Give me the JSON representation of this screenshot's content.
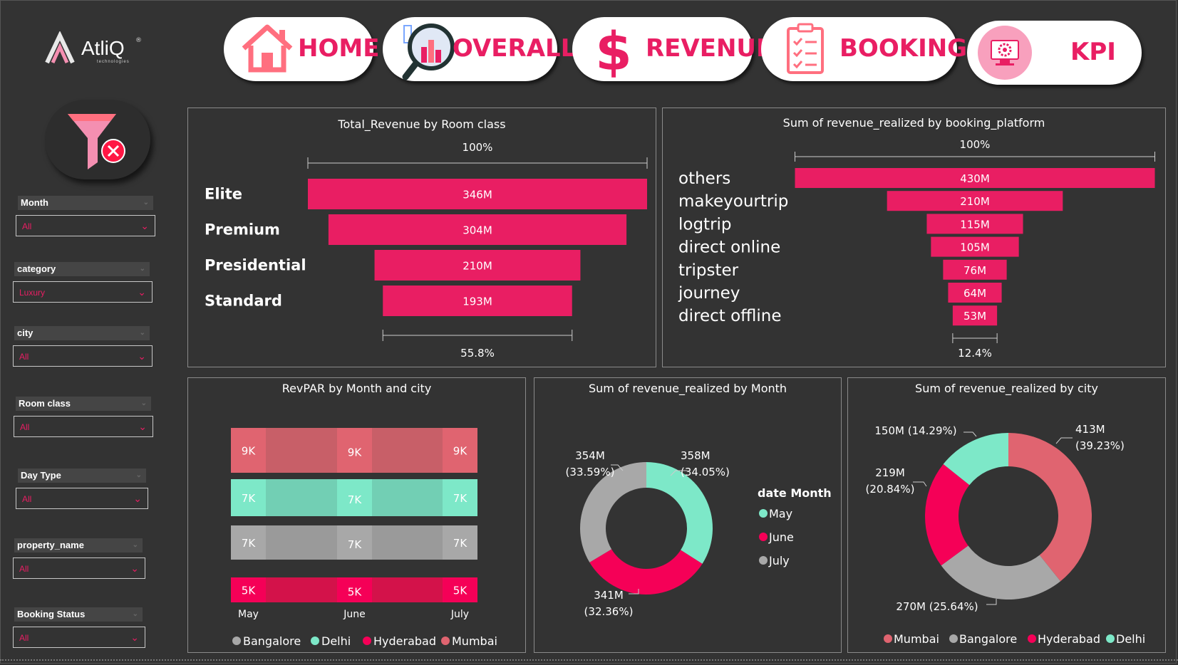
{
  "logo": {
    "name": "AtliQ",
    "sub": "technologies",
    "reg": "®"
  },
  "nav": [
    {
      "label": "HOME",
      "icon": "house-icon"
    },
    {
      "label": "OVERALL",
      "icon": "magnifier-chart-icon"
    },
    {
      "label": "REVENUE",
      "icon": "dollar-icon"
    },
    {
      "label": "BOOKING",
      "icon": "clipboard-checklist-icon"
    },
    {
      "label": "KPI",
      "icon": "gear-monitor-icon"
    }
  ],
  "filters": {
    "clear_icon": "funnel-clear-icon",
    "slicers": [
      {
        "title": "Month",
        "value": "All"
      },
      {
        "title": "category",
        "value": "Luxury"
      },
      {
        "title": "city",
        "value": "All"
      },
      {
        "title": "Room class",
        "value": "All"
      },
      {
        "title": "Day Type",
        "value": "All"
      },
      {
        "title": "property_name",
        "value": "All"
      },
      {
        "title": "Booking Status",
        "value": "All"
      }
    ]
  },
  "colors": {
    "pink": "#e91e63",
    "mumbai": "#e06470",
    "bangalore": "#a8a8a8",
    "hyderabad": "#f50057",
    "delhi": "#7de8c8"
  },
  "chart_data": [
    {
      "type": "bar",
      "subtype": "funnel",
      "title": "Total_Revenue by Room class",
      "categories": [
        "Elite",
        "Premium",
        "Presidential",
        "Standard"
      ],
      "values": [
        346,
        304,
        210,
        193
      ],
      "value_labels": [
        "346M",
        "304M",
        "210M",
        "193M"
      ],
      "top_label": "100%",
      "bottom_label": "55.8%"
    },
    {
      "type": "bar",
      "subtype": "funnel",
      "title": "Sum of revenue_realized by booking_platform",
      "categories": [
        "others",
        "makeyourtrip",
        "logtrip",
        "direct online",
        "tripster",
        "journey",
        "direct offline"
      ],
      "values": [
        430,
        210,
        115,
        105,
        76,
        64,
        53
      ],
      "value_labels": [
        "430M",
        "210M",
        "115M",
        "105M",
        "76M",
        "64M",
        "53M"
      ],
      "top_label": "100%",
      "bottom_label": "12.4%"
    },
    {
      "type": "bar",
      "subtype": "ribbon",
      "title": "RevPAR by Month and city",
      "categories": [
        "May",
        "June",
        "July"
      ],
      "series": [
        {
          "name": "Mumbai",
          "values": [
            9,
            9,
            9
          ],
          "labels": [
            "9K",
            "9K",
            "9K"
          ]
        },
        {
          "name": "Delhi",
          "values": [
            7,
            7,
            7
          ],
          "labels": [
            "7K",
            "7K",
            "7K"
          ]
        },
        {
          "name": "Bangalore",
          "values": [
            7,
            7,
            7
          ],
          "labels": [
            "7K",
            "7K",
            "7K"
          ]
        },
        {
          "name": "Hyderabad",
          "values": [
            5,
            5,
            5
          ],
          "labels": [
            "5K",
            "5K",
            "5K"
          ]
        }
      ],
      "legend": [
        "Bangalore",
        "Delhi",
        "Hyderabad",
        "Mumbai"
      ],
      "legend_position": "bottom"
    },
    {
      "type": "pie",
      "subtype": "donut",
      "title": "Sum of revenue_realized by Month",
      "legend_title": "date Month",
      "slices": [
        {
          "name": "May",
          "value": 358,
          "label": "358M",
          "pct": "(34.05%)"
        },
        {
          "name": "June",
          "value": 341,
          "label": "341M",
          "pct": "(32.36%)"
        },
        {
          "name": "July",
          "value": 354,
          "label": "354M",
          "pct": "(33.59%)"
        }
      ],
      "legend_position": "right"
    },
    {
      "type": "pie",
      "subtype": "donut",
      "title": "Sum of revenue_realized by city",
      "slices": [
        {
          "name": "Mumbai",
          "value": 413,
          "label": "413M",
          "pct": "(39.23%)"
        },
        {
          "name": "Bangalore",
          "value": 270,
          "label": "270M",
          "pct": "(25.64%)"
        },
        {
          "name": "Hyderabad",
          "value": 219,
          "label": "219M",
          "pct": "(20.84%)"
        },
        {
          "name": "Delhi",
          "value": 150,
          "label": "150M",
          "pct": "(14.29%)"
        }
      ],
      "legend_position": "bottom"
    }
  ]
}
